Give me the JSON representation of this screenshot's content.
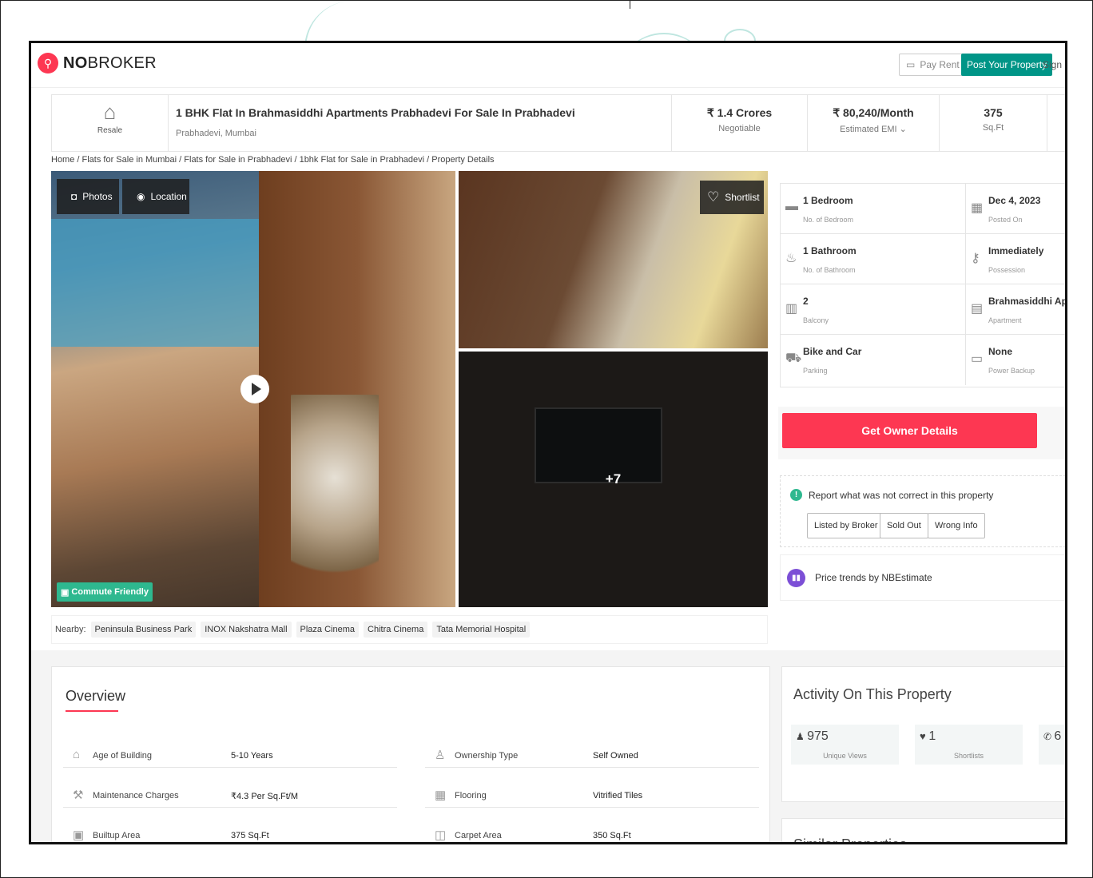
{
  "header": {
    "brand_prefix": "NO",
    "brand_suffix": "BROKER",
    "pay_rent": "Pay Rent",
    "post_property": "Post Your Property",
    "sign_up": "Sign up"
  },
  "title_strip": {
    "badge": "Resale",
    "title": "1 BHK Flat In Brahmasiddhi Apartments Prabhadevi For Sale In Prabhadevi",
    "location": "Prabhadevi, Mumbai",
    "price": "₹ 1.4 Crores",
    "price_note": "Negotiable",
    "emi": "₹ 80,240/Month",
    "emi_note": "Estimated EMI ⌄",
    "area": "375",
    "area_unit": "Sq.Ft"
  },
  "breadcrumb": "Home / Flats for Sale in Mumbai / Flats for Sale in Prabhadevi / 1bhk Flat for Sale in Prabhadevi / Property Details",
  "gallery": {
    "photos": "Photos",
    "location": "Location",
    "shortlist": "Shortlist",
    "more": "+7",
    "commute": "Commute Friendly"
  },
  "nearby": {
    "label": "Nearby:",
    "places": [
      "Peninsula Business Park",
      "INOX Nakshatra Mall",
      "Plaza Cinema",
      "Chitra Cinema",
      "Tata Memorial Hospital"
    ]
  },
  "details": [
    {
      "value": "1 Bedroom",
      "label": "No. of Bedroom",
      "icon": "bed-icon"
    },
    {
      "value": "Dec 4, 2023",
      "label": "Posted On",
      "icon": "calendar-icon"
    },
    {
      "value": "1 Bathroom",
      "label": "No. of Bathroom",
      "icon": "bath-icon"
    },
    {
      "value": "Immediately",
      "label": "Possession",
      "icon": "key-icon"
    },
    {
      "value": "2",
      "label": "Balcony",
      "icon": "balcony-icon"
    },
    {
      "value": "Brahmasiddhi Apar...",
      "label": "Apartment",
      "icon": "building-icon"
    },
    {
      "value": "Bike and Car",
      "label": "Parking",
      "icon": "car-icon"
    },
    {
      "value": "None",
      "label": "Power Backup",
      "icon": "battery-icon"
    }
  ],
  "owner_button": "Get Owner Details",
  "report": {
    "text": "Report what was not correct in this property",
    "options": [
      "Listed by Broker",
      "Sold Out",
      "Wrong Info"
    ]
  },
  "price_trends": "Price trends by NBEstimate",
  "overview": {
    "title": "Overview",
    "rows": [
      {
        "key": "Age of Building",
        "value": "5-10 Years",
        "icon": "building-age-icon"
      },
      {
        "key": "Ownership Type",
        "value": "Self Owned",
        "icon": "ownership-icon"
      },
      {
        "key": "Maintenance Charges",
        "value": "₹4.3 Per Sq.Ft/M",
        "icon": "tools-icon"
      },
      {
        "key": "Flooring",
        "value": "Vitrified Tiles",
        "icon": "flooring-icon"
      },
      {
        "key": "Builtup Area",
        "value": "375 Sq.Ft",
        "icon": "builtup-icon"
      },
      {
        "key": "Carpet Area",
        "value": "350 Sq.Ft",
        "icon": "carpet-icon"
      }
    ]
  },
  "activity": {
    "title": "Activity On This Property",
    "stats": [
      {
        "value": "975",
        "label": "Unique Views",
        "icon": "user-icon"
      },
      {
        "value": "1",
        "label": "Shortlists",
        "icon": "heart-icon"
      },
      {
        "value": "6",
        "label": "",
        "icon": "phone-icon"
      }
    ]
  },
  "similar_title": "Similar Properties"
}
